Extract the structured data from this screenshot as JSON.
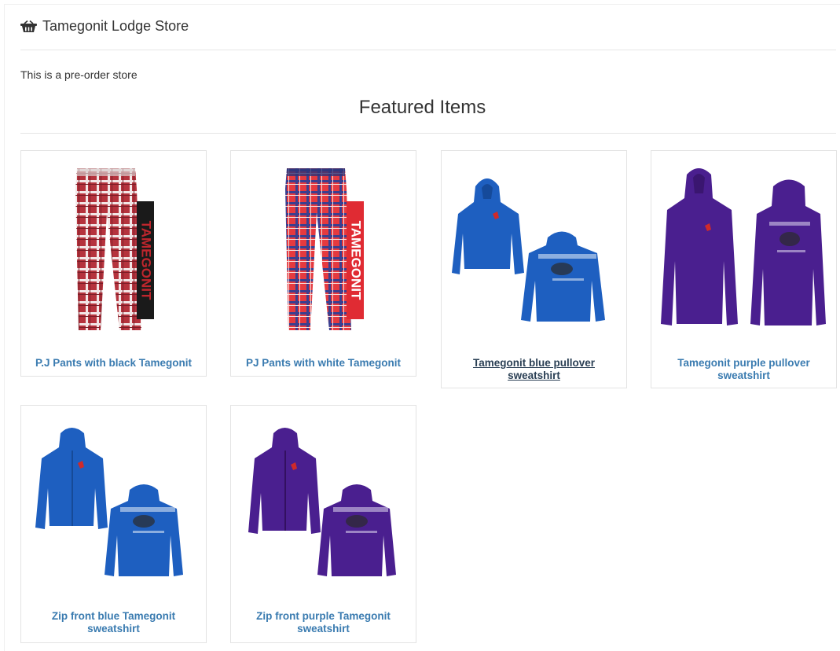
{
  "store": {
    "title": "Tamegonit Lodge Store",
    "icon": "basket-icon",
    "intro": "This is a pre-order store"
  },
  "featured": {
    "heading": "Featured Items"
  },
  "colors": {
    "link": "#3a7bb0",
    "hovered_link": "#2a3f54",
    "plaid_red": "#b5333d",
    "plaid_bright": "#e53a3f",
    "royal_blue": "#1e5fc0",
    "purple": "#4a1f8f"
  },
  "products": [
    {
      "name": "P.J Pants with black Tamegonit",
      "image": "plaid-pants-black-banner",
      "banner_text": "TAMEGONIT"
    },
    {
      "name": "PJ Pants with white Tamegonit",
      "image": "plaid-pants-white-banner",
      "banner_text": "TAMEGONIT"
    },
    {
      "name": "Tamegonit blue pullover sweatshirt",
      "image": "blue-pullover-hoodie"
    },
    {
      "name": "Tamegonit purple pullover sweatshirt",
      "image": "purple-pullover-hoodie"
    },
    {
      "name": "Zip front blue Tamegonit sweatshirt",
      "image": "blue-zip-hoodie"
    },
    {
      "name": "Zip front purple Tamegonit sweatshirt",
      "image": "purple-zip-hoodie"
    }
  ]
}
